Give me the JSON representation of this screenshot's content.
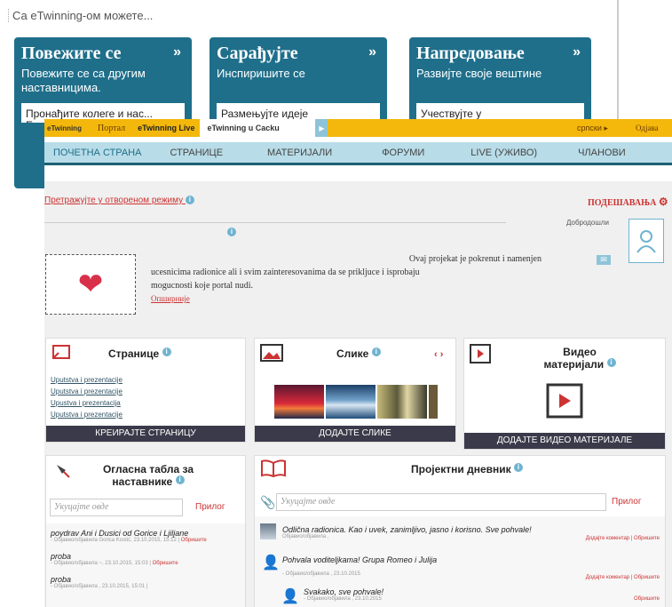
{
  "intro": "Са eTwinning-ом можете...",
  "cards": [
    {
      "title": "Повежите се",
      "text": "Повежите се са другим наставницима.",
      "inner": "Пронађите колеге и нас... Евр..."
    },
    {
      "title": "Сарађујте",
      "text": "Инспиришите се",
      "inner": "Размењујте идеје"
    },
    {
      "title": "Напредовање",
      "text": "Развијте своје вештине",
      "inner": "Учествујте у"
    }
  ],
  "topbar": {
    "logo": "eTwinning",
    "portal": "Портал",
    "live": "eTwinning Live",
    "tab": "eTwinning u Cacku",
    "lang": "српски ▸",
    "logout": "Одјава"
  },
  "nav": [
    "ПОЧЕТНА СТРАНА",
    "СТРАНИЦЕ",
    "МАТЕРИЈАЛИ",
    "ФОРУМИ",
    "LIVE (УЖИВО)",
    "ЧЛАНОВИ"
  ],
  "search_link": "Претражујте у отвореном режиму",
  "settings": "ПОДЕШАВАЊА",
  "welcome": "Добродошли",
  "description": {
    "line1": "Ovaj projekat je pokrenut i namenjen",
    "line2": "ucesnicima radionice ali i svim zainteresovanima da se prikljuce i isprobaju",
    "line3": "mogucnosti koje portal nudi.",
    "more": "Опширније"
  },
  "pages_box": {
    "title": "Странице",
    "links": [
      "Uputstva i prezentacije",
      "Uputstva i prezentacije",
      "Upustva i prezentacija",
      "Uputstva i prezentacije"
    ],
    "button": "КРЕИРАЈТЕ СТРАНИЦУ"
  },
  "images_box": {
    "title": "Слике",
    "nav": "‹ ›",
    "button": "ДОДАЈТЕ СЛИКЕ"
  },
  "video_box": {
    "title": "Видео материјали",
    "button": "ДОДАЈТЕ ВИДЕО МАТЕРИЈАЛЕ"
  },
  "board": {
    "title": "Огласна табла за наставнике",
    "placeholder": "Укуцајте овде",
    "attach": "Прилог",
    "items": [
      {
        "text": "poydrav Ani i Dusici od Gorice i Ljiljane",
        "meta": "- Објавио/објавила Gorica Kostić, 23.10.2015, 15:12 |",
        "del": "Обришите"
      },
      {
        "text": "proba",
        "meta": "- Објавио/објавила ~, 23.10.2015, 15:03 |",
        "del": "Обришите"
      },
      {
        "text": "proba",
        "meta": "- Објавио/објавила , 23.10.2015, 15:01 |",
        "del": ""
      }
    ]
  },
  "diary": {
    "title": "Пројектни дневник",
    "placeholder": "Укуцајте овде",
    "attach": "Прилог",
    "items": [
      {
        "text": "Odlična radionica. Kao i uvek, zanimljivo, jasno i korisno. Sve pohvale!",
        "meta": "Објавио/објавила ,",
        "actions": "Додајте коментар | Обришите"
      },
      {
        "text": "Pohvala voditeljkama! Grupa Romeo i Julija",
        "meta": "- Објавио/објавила , 23.10.2015",
        "actions": "Додајте коментар | Обришите"
      },
      {
        "text": "Svakako, sve pohvale!",
        "meta": "- Објавио/објавила , 23.10.2015",
        "actions": "Обришите"
      }
    ]
  }
}
